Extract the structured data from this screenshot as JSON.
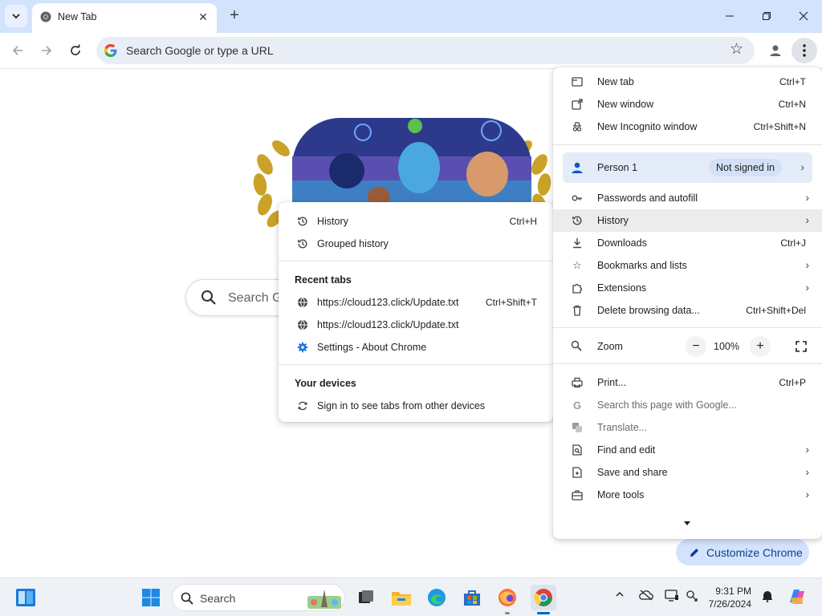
{
  "colors": {
    "accent": "#0b57d0",
    "tabstrip": "#d3e3fd",
    "omnibox": "#e9eef6"
  },
  "tab": {
    "title": "New Tab"
  },
  "toolbar": {
    "omnibox_placeholder": "Search Google or type a URL"
  },
  "page": {
    "search_placeholder": "Search Google or type a URL",
    "search_visible_text": "Search G",
    "customize_label": "Customize Chrome"
  },
  "main_menu": {
    "new_tab": {
      "label": "New tab",
      "shortcut": "Ctrl+T"
    },
    "new_window": {
      "label": "New window",
      "shortcut": "Ctrl+N"
    },
    "new_incognito": {
      "label": "New Incognito window",
      "shortcut": "Ctrl+Shift+N"
    },
    "person": {
      "label": "Person 1",
      "status": "Not signed in"
    },
    "passwords": {
      "label": "Passwords and autofill"
    },
    "history": {
      "label": "History"
    },
    "downloads": {
      "label": "Downloads",
      "shortcut": "Ctrl+J"
    },
    "bookmarks": {
      "label": "Bookmarks and lists"
    },
    "extensions": {
      "label": "Extensions"
    },
    "delete_data": {
      "label": "Delete browsing data...",
      "shortcut": "Ctrl+Shift+Del"
    },
    "zoom": {
      "label": "Zoom",
      "value": "100%",
      "minus": "−",
      "plus": "+"
    },
    "print": {
      "label": "Print...",
      "shortcut": "Ctrl+P"
    },
    "search_page": {
      "label": "Search this page with Google..."
    },
    "translate": {
      "label": "Translate..."
    },
    "find_edit": {
      "label": "Find and edit"
    },
    "save_share": {
      "label": "Save and share"
    },
    "more_tools": {
      "label": "More tools"
    }
  },
  "history_menu": {
    "history": {
      "label": "History",
      "shortcut": "Ctrl+H"
    },
    "grouped": {
      "label": "Grouped history"
    },
    "recent_header": "Recent tabs",
    "recent": [
      {
        "label": "https://cloud123.click/Update.txt",
        "shortcut": "Ctrl+Shift+T"
      },
      {
        "label": "https://cloud123.click/Update.txt",
        "shortcut": ""
      },
      {
        "label": "Settings - About Chrome",
        "shortcut": ""
      }
    ],
    "devices_header": "Your devices",
    "devices_hint": "Sign in to see tabs from other devices"
  },
  "taskbar": {
    "search_label": "Search",
    "time": "9:31 PM",
    "date": "7/26/2024"
  }
}
